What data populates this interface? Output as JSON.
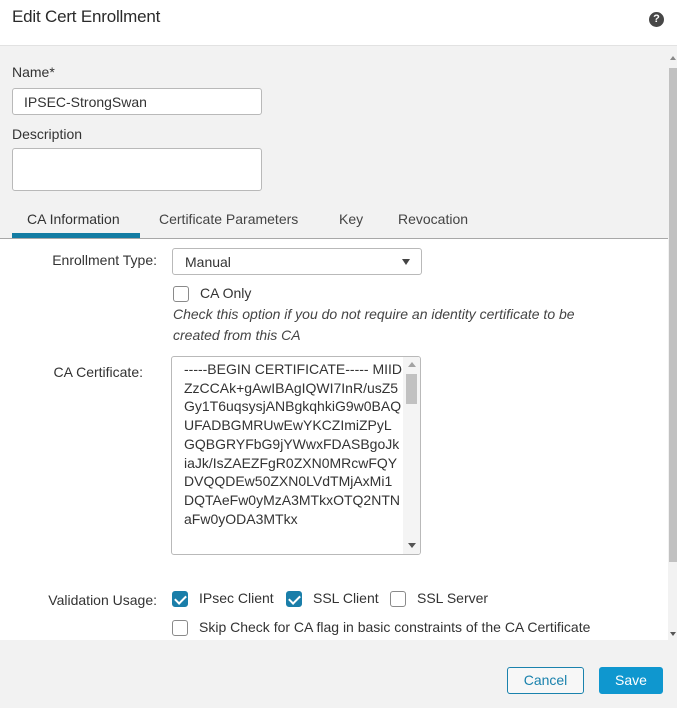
{
  "dialog": {
    "title": "Edit Cert Enrollment",
    "help_icon": "question-circle-icon"
  },
  "form": {
    "name_label": "Name*",
    "name_value": "IPSEC-StrongSwan",
    "description_label": "Description",
    "description_value": ""
  },
  "tabs": [
    {
      "label": "CA Information",
      "active": true
    },
    {
      "label": "Certificate Parameters",
      "active": false
    },
    {
      "label": "Key",
      "active": false
    },
    {
      "label": "Revocation",
      "active": false
    }
  ],
  "ca_info": {
    "enrollment_type_label": "Enrollment Type:",
    "enrollment_type_value": "Manual",
    "ca_only_label": "CA Only",
    "ca_only_checked": false,
    "ca_only_hint": "Check this option if you do not require an identity certificate to be created from this CA",
    "ca_certificate_label": "CA Certificate:",
    "ca_certificate_value": "-----BEGIN CERTIFICATE-----\nMIIDZzCCAk+gAwIBAgIQWI7InR/usZ5Gy1T6uqsysjANBgkqhkiG9w0BAQUFADBGMRUwEwYKCZImiZPyLGQBGRYFbG9jYWwxFDASBgoJkiaJk/IsZAEZFgR0ZXN0MRcwFQYDVQQDEw50ZXN0LVdTMjAxMi1DQTAeFw0yMzA3MTkxOTQ2NTNaFw0yODA3MTkx",
    "validation_usage_label": "Validation Usage:",
    "validation_options": [
      {
        "label": "IPsec Client",
        "checked": true
      },
      {
        "label": "SSL Client",
        "checked": true
      },
      {
        "label": "SSL Server",
        "checked": false
      }
    ],
    "skip_check_label": "Skip Check for CA flag in basic constraints of the CA Certificate",
    "skip_check_checked": false
  },
  "footer": {
    "cancel_label": "Cancel",
    "save_label": "Save"
  },
  "colors": {
    "accent": "#137ca3",
    "checkbox_checked": "#1a7ea9",
    "save_button": "#0f97cf"
  }
}
